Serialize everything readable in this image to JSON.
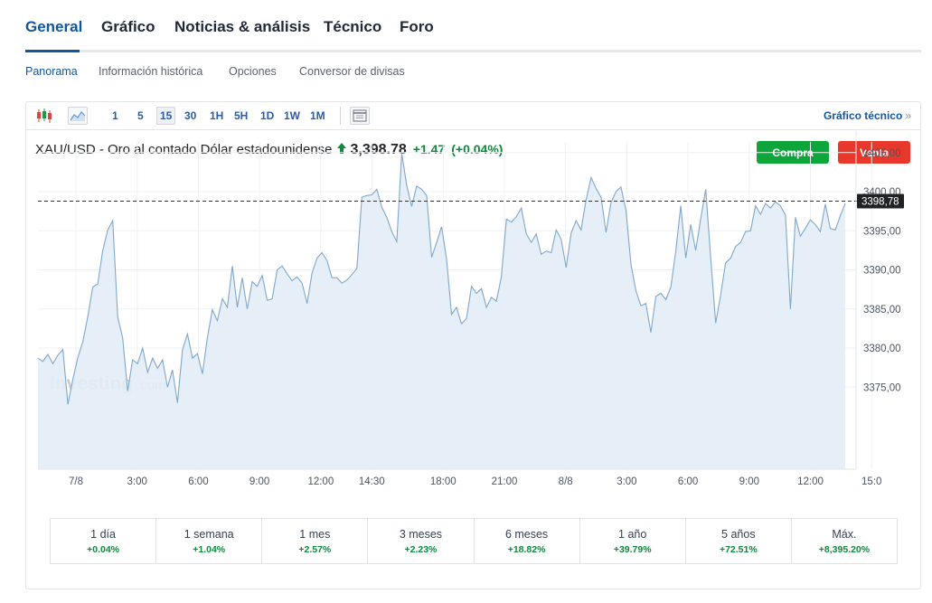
{
  "main_tabs": [
    {
      "label": "General",
      "active": true
    },
    {
      "label": "Gráfico"
    },
    {
      "label": "Noticias & análisis"
    },
    {
      "label": "Técnico"
    },
    {
      "label": "Foro"
    }
  ],
  "sub_tabs": [
    {
      "label": "Panorama",
      "active": true
    },
    {
      "label": "Información histórica"
    },
    {
      "label": "Opciones"
    },
    {
      "label": "Conversor de divisas"
    }
  ],
  "toolbar": {
    "icons": [
      "candlestick-icon",
      "area-chart-icon",
      "table-view-icon"
    ],
    "intervals": [
      "1",
      "5",
      "15",
      "30",
      "1H",
      "5H",
      "1D",
      "1W",
      "1M"
    ],
    "active_interval": "15",
    "technical_link": "Gráfico técnico",
    "technical_arrow": "»"
  },
  "instrument": {
    "name": "XAU/USD - Oro al contado Dólar estadounidense",
    "arrow": "🡅",
    "price": "3,398.78",
    "change": "+1.47",
    "change_pct": "(+0.04%)",
    "buy_label": "Compra",
    "sell_label": "Venta"
  },
  "watermark": {
    "brand": "Investing",
    "suffix": ".com"
  },
  "colors": {
    "accent": "#1256a0",
    "up": "#0a8a3a",
    "buy": "#0ea63a",
    "sell": "#e8382b",
    "line": "#7fa7cc",
    "area": "#e3edf6"
  },
  "chart_data": {
    "type": "area",
    "y_ticks": [
      "3405,00",
      "3400,00",
      "3395,00",
      "3390,00",
      "3385,00",
      "3380,00",
      "3375,00"
    ],
    "y_tick_values": [
      3405,
      3400,
      3395,
      3390,
      3385,
      3380,
      3375
    ],
    "ylim": [
      3370,
      3407.5
    ],
    "x_ticks": [
      "7/8",
      "3:00",
      "6:00",
      "9:00",
      "12:00",
      "14:30",
      "18:00",
      "21:00",
      "8/8",
      "3:00",
      "6:00",
      "9:00",
      "12:00",
      "15:0"
    ],
    "x_tick_positions": [
      1.0,
      4.0,
      7.0,
      10.0,
      13.0,
      15.5,
      19.0,
      22.0,
      25.0,
      28.0,
      31.0,
      34.0,
      37.0,
      40.0
    ],
    "current_label": "3398,78",
    "current_value": 3398.78,
    "grid": true,
    "values": [
      3378.7,
      3378.3,
      3379.2,
      3378.0,
      3379.1,
      3379.8,
      3372.8,
      3376.0,
      3378.8,
      3380.8,
      3384.0,
      3387.8,
      3388.2,
      3392.5,
      3395.1,
      3396.3,
      3384.0,
      3381.3,
      3374.5,
      3378.5,
      3378.0,
      3380.0,
      3376.9,
      3378.7,
      3377.4,
      3378.5,
      3375.0,
      3377.2,
      3373.0,
      3379.8,
      3381.8,
      3378.7,
      3379.3,
      3376.7,
      3381.3,
      3384.9,
      3383.5,
      3386.3,
      3385.2,
      3390.5,
      3385.2,
      3389.0,
      3385.0,
      3388.5,
      3387.9,
      3389.3,
      3386.1,
      3386.3,
      3390.0,
      3390.5,
      3389.5,
      3388.6,
      3389.1,
      3388.3,
      3385.7,
      3389.6,
      3391.5,
      3392.2,
      3391.2,
      3389.0,
      3389.0,
      3388.3,
      3388.7,
      3389.4,
      3390.2,
      3399.3,
      3399.5,
      3399.6,
      3400.3,
      3398.0,
      3396.7,
      3394.9,
      3393.6,
      3404.9,
      3400.8,
      3398.1,
      3400.7,
      3400.3,
      3399.5,
      3391.6,
      3393.5,
      3395.5,
      3391.4,
      3384.3,
      3385.2,
      3383.1,
      3383.8,
      3387.9,
      3387.0,
      3387.6,
      3385.2,
      3386.5,
      3386.0,
      3389.1,
      3396.5,
      3396.1,
      3396.8,
      3397.9,
      3394.6,
      3393.5,
      3394.6,
      3392.0,
      3392.4,
      3392.2,
      3395.1,
      3393.9,
      3390.3,
      3394.7,
      3396.3,
      3395.1,
      3399.0,
      3401.8,
      3400.4,
      3399.3,
      3394.8,
      3398.6,
      3400.0,
      3400.6,
      3397.6,
      3390.7,
      3387.3,
      3385.4,
      3385.7,
      3382.0,
      3386.6,
      3387.0,
      3386.2,
      3387.8,
      3392.4,
      3398.2,
      3391.5,
      3395.8,
      3392.5,
      3396.5,
      3400.3,
      3391.5,
      3383.2,
      3386.8,
      3390.9,
      3391.5,
      3393.0,
      3393.5,
      3394.9,
      3395.0,
      3398.2,
      3397.1,
      3398.5,
      3397.9,
      3398.7,
      3398.2,
      3397.0,
      3385.0,
      3396.7,
      3394.3,
      3395.3,
      3396.4,
      3395.8,
      3394.9,
      3398.4,
      3395.3,
      3395.1,
      3396.9,
      3398.5
    ]
  },
  "performance": [
    {
      "label": "1 día",
      "value": "+0.04%"
    },
    {
      "label": "1 semana",
      "value": "+1.04%"
    },
    {
      "label": "1 mes",
      "value": "+2.57%"
    },
    {
      "label": "3 meses",
      "value": "+2.23%"
    },
    {
      "label": "6 meses",
      "value": "+18.82%"
    },
    {
      "label": "1 año",
      "value": "+39.79%"
    },
    {
      "label": "5 años",
      "value": "+72.51%"
    },
    {
      "label": "Máx.",
      "value": "+8,395.20%"
    }
  ]
}
